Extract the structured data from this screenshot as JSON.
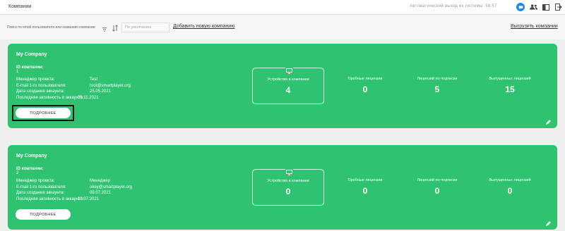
{
  "header": {
    "title": "Компании",
    "auto_logout": "Автоматический выход из системы: 58:57",
    "icons": [
      "chat-icon",
      "users-icon",
      "panel-icon",
      "exit-icon"
    ],
    "accent_color": "#1e88e5"
  },
  "toolbar": {
    "search_placeholder": "Поиск по email пользователя или названию компании",
    "sort_value": "По умолчанию",
    "add_company": "Добавить новую компанию",
    "export": "Выгрузить компании"
  },
  "labels": {
    "id": "ID компании:",
    "manager": "Менеджер проекта:",
    "email": "E-mail 1-го пользователя:",
    "created": "Дата создания аккаунта:",
    "last_active": "Последняя активность в аккаунте:",
    "details": "ПОДРОБНЕЕ",
    "devices": "Устройства в компании",
    "trial": "Пробные лицензии",
    "subscription": "Лицензий по подписке",
    "issued": "Выпущенных лицензий"
  },
  "card_color": "#2ec271",
  "companies": [
    {
      "name": "My Company",
      "id": "1",
      "manager": "Test",
      "email": "root@smartplayer.org",
      "created": "25.05.2021",
      "last_active": "09.11.2021",
      "devices": "4",
      "trial": "0",
      "subscription": "5",
      "issued": "15"
    },
    {
      "name": "My Company",
      "id": "2",
      "manager": "Менеджер",
      "email": "okey@smartplayer.org",
      "created": "09.07.2021",
      "last_active": "12.07.2021",
      "devices": "0",
      "trial": "0",
      "subscription": "0",
      "issued": "0"
    }
  ]
}
